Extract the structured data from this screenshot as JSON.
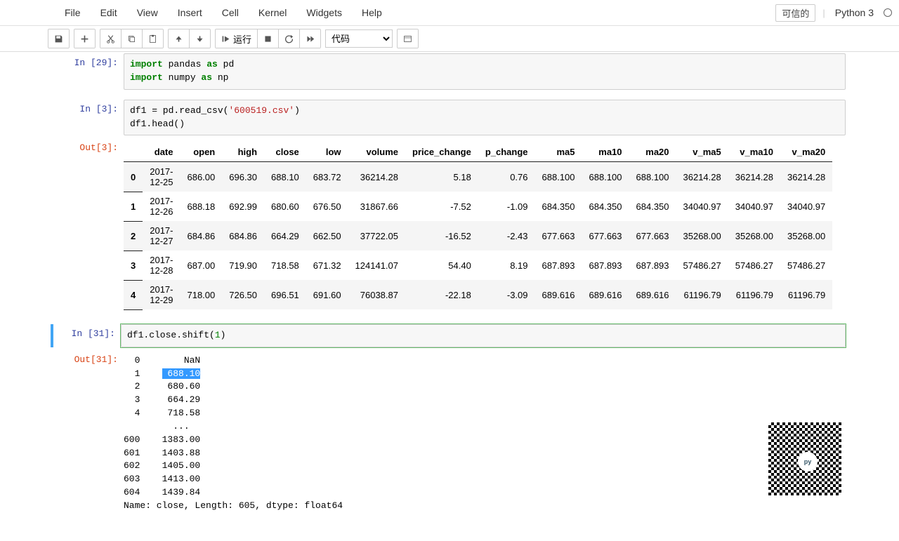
{
  "menubar": {
    "items": [
      "File",
      "Edit",
      "View",
      "Insert",
      "Cell",
      "Kernel",
      "Widgets",
      "Help"
    ],
    "trusted": "可信的",
    "kernel": "Python 3"
  },
  "toolbar": {
    "run_label": "运行",
    "celltype": "代码"
  },
  "cells": {
    "c0": {
      "in_label": "In [29]:",
      "code": "import pandas as pd\nimport numpy as np"
    },
    "c1": {
      "in_label": "In [3]:",
      "code": "df1 = pd.read_csv('600519.csv')\ndf1.head()",
      "out_label": "Out[3]:",
      "df": {
        "cols": [
          "date",
          "open",
          "high",
          "close",
          "low",
          "volume",
          "price_change",
          "p_change",
          "ma5",
          "ma10",
          "ma20",
          "v_ma5",
          "v_ma10",
          "v_ma20"
        ],
        "idx": [
          "0",
          "1",
          "2",
          "3",
          "4"
        ],
        "rows": [
          [
            "2017-12-25",
            "686.00",
            "696.30",
            "688.10",
            "683.72",
            "36214.28",
            "5.18",
            "0.76",
            "688.100",
            "688.100",
            "688.100",
            "36214.28",
            "36214.28",
            "36214.28"
          ],
          [
            "2017-12-26",
            "688.18",
            "692.99",
            "680.60",
            "676.50",
            "31867.66",
            "-7.52",
            "-1.09",
            "684.350",
            "684.350",
            "684.350",
            "34040.97",
            "34040.97",
            "34040.97"
          ],
          [
            "2017-12-27",
            "684.86",
            "684.86",
            "664.29",
            "662.50",
            "37722.05",
            "-16.52",
            "-2.43",
            "677.663",
            "677.663",
            "677.663",
            "35268.00",
            "35268.00",
            "35268.00"
          ],
          [
            "2017-12-28",
            "687.00",
            "719.90",
            "718.58",
            "671.32",
            "124141.07",
            "54.40",
            "8.19",
            "687.893",
            "687.893",
            "687.893",
            "57486.27",
            "57486.27",
            "57486.27"
          ],
          [
            "2017-12-29",
            "718.00",
            "726.50",
            "696.51",
            "691.60",
            "76038.87",
            "-22.18",
            "-3.09",
            "689.616",
            "689.616",
            "689.616",
            "61196.79",
            "61196.79",
            "61196.79"
          ]
        ]
      }
    },
    "c2": {
      "in_label": "In [31]:",
      "code": "df1.close.shift(1)",
      "out_label": "Out[31]:",
      "series": {
        "highlight_idx": 1,
        "top": [
          [
            "0",
            "NaN"
          ],
          [
            "1",
            "688.10"
          ],
          [
            "2",
            "680.60"
          ],
          [
            "3",
            "664.29"
          ],
          [
            "4",
            "718.58"
          ]
        ],
        "ellipsis": "...",
        "bottom": [
          [
            "600",
            "1383.00"
          ],
          [
            "601",
            "1403.88"
          ],
          [
            "602",
            "1405.00"
          ],
          [
            "603",
            "1413.00"
          ],
          [
            "604",
            "1439.84"
          ]
        ],
        "footer": "Name: close, Length: 605, dtype: float64"
      }
    }
  },
  "chart_data": {
    "type": "table",
    "title": "df1.head()",
    "columns": [
      "date",
      "open",
      "high",
      "close",
      "low",
      "volume",
      "price_change",
      "p_change",
      "ma5",
      "ma10",
      "ma20",
      "v_ma5",
      "v_ma10",
      "v_ma20"
    ],
    "index": [
      0,
      1,
      2,
      3,
      4
    ],
    "rows": [
      [
        "2017-12-25",
        686.0,
        696.3,
        688.1,
        683.72,
        36214.28,
        5.18,
        0.76,
        688.1,
        688.1,
        688.1,
        36214.28,
        36214.28,
        36214.28
      ],
      [
        "2017-12-26",
        688.18,
        692.99,
        680.6,
        676.5,
        31867.66,
        -7.52,
        -1.09,
        684.35,
        684.35,
        684.35,
        34040.97,
        34040.97,
        34040.97
      ],
      [
        "2017-12-27",
        684.86,
        684.86,
        664.29,
        662.5,
        37722.05,
        -16.52,
        -2.43,
        677.663,
        677.663,
        677.663,
        35268.0,
        35268.0,
        35268.0
      ],
      [
        "2017-12-28",
        687.0,
        719.9,
        718.58,
        671.32,
        124141.07,
        54.4,
        8.19,
        687.893,
        687.893,
        687.893,
        57486.27,
        57486.27,
        57486.27
      ],
      [
        "2017-12-29",
        718.0,
        726.5,
        696.51,
        691.6,
        76038.87,
        -22.18,
        -3.09,
        689.616,
        689.616,
        689.616,
        61196.79,
        61196.79,
        61196.79
      ]
    ]
  }
}
